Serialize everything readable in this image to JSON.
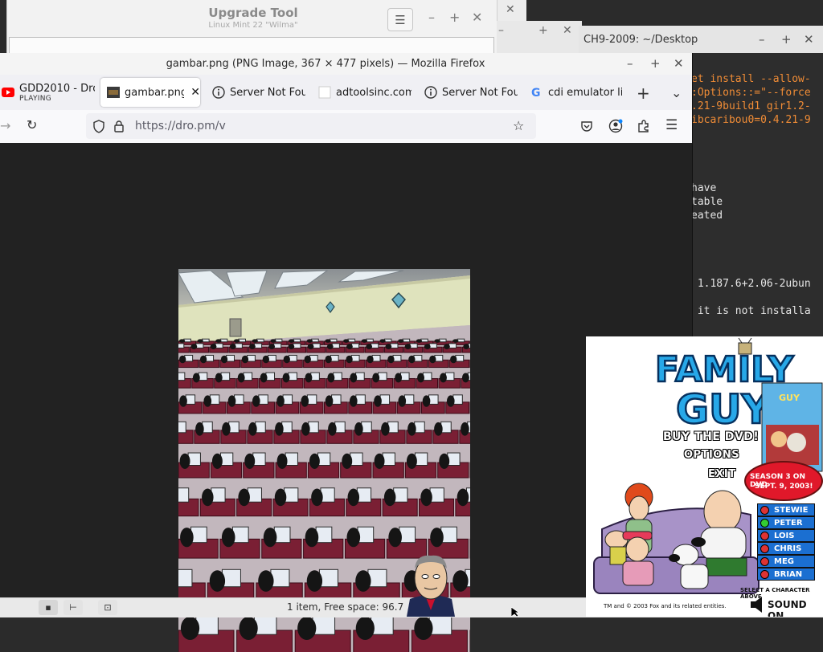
{
  "upgrade_tool": {
    "title": "Upgrade Tool",
    "subtitle": "Linux Mint 22 \"Wilma\""
  },
  "terminal": {
    "title": "CH9-2009: ~/Desktop",
    "lines": [
      {
        "text": "et install --allow-",
        "color": "orange"
      },
      {
        "text": ":Options::=\"--force",
        "color": "orange"
      },
      {
        "text": ".21-9build1 gir1.2-",
        "color": "orange"
      },
      {
        "text": "ibcaribou0=0.4.21-9",
        "color": "orange"
      },
      {
        "text": "have",
        "color": "light"
      },
      {
        "text": "table",
        "color": "light"
      },
      {
        "text": "eated",
        "color": "light"
      },
      {
        "text": " 1.187.6+2.06-2ubun",
        "color": "light"
      },
      {
        "text": " it is not installa",
        "color": "light"
      }
    ]
  },
  "firefox": {
    "window_title": "gambar.png (PNG Image, 367 × 477 pixels) — Mozilla Firefox",
    "tabs": [
      {
        "label": "GDD2010 - Dro",
        "sub": "PLAYING",
        "icon": "youtube-icon"
      },
      {
        "label": "gambar.png",
        "icon": "image-thumbnail-icon",
        "active": true
      },
      {
        "label": "Server Not Fou",
        "icon": "info-icon"
      },
      {
        "label": "adtoolsinc.com",
        "icon": "blank-page-icon"
      },
      {
        "label": "Server Not Fou",
        "icon": "info-icon"
      },
      {
        "label": "cdi emulator lir",
        "icon": "google-icon"
      }
    ],
    "url": "https://dro.pm/v"
  },
  "statusbar": {
    "text": "1 item, Free space: 96.7"
  },
  "family_guy": {
    "logo_top": "FAMILY",
    "logo_bottom": "GUY",
    "menu": [
      "BUY THE DVD!",
      "OPTIONS",
      "EXIT"
    ],
    "promo": [
      "SEASON 3 ON DVD",
      "SEPT. 9, 2003!"
    ],
    "characters": [
      "STEWIE",
      "PETER",
      "LOIS",
      "CHRIS",
      "MEG",
      "BRIAN"
    ],
    "selected_character": "PETER",
    "instruction": "SELECT A CHARACTER ABOVE",
    "copyright": "TM and © 2003 Fox and its related entities.",
    "sound_label": "SOUND ON"
  },
  "colors": {
    "terminal_orange": "#f08c36",
    "fg_blue": "#1b6fd1",
    "promo_red": "#e0182a"
  }
}
